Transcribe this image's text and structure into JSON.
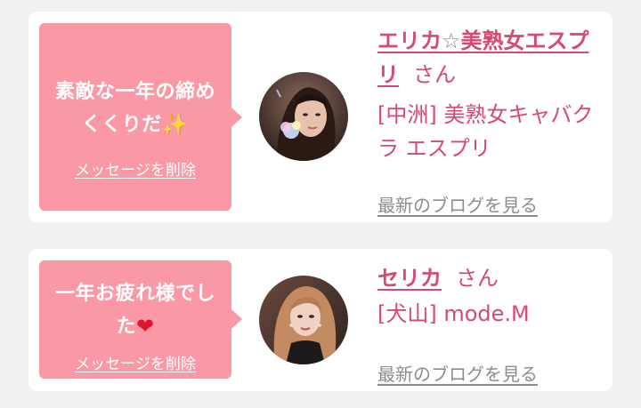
{
  "messages": [
    {
      "text": "素敵な一年の締めくくりだ",
      "emoji_icon": "sparkle-icon",
      "emoji": "✨",
      "delete_label": "メッセージを削除",
      "name_part1": "エリカ",
      "star": "☆",
      "name_part2": "美熟女エスプリ",
      "honorific": "さん",
      "shop": "[中洲] 美熟女キャバクラ エスプリ",
      "blog_label": "最新のブログを見る"
    },
    {
      "text": "一年お疲れ様でした",
      "emoji_icon": "heart-icon",
      "emoji": "❤",
      "delete_label": "メッセージを削除",
      "name": "セリカ",
      "honorific": "さん",
      "shop": "[犬山] mode.M",
      "blog_label": "最新のブログを見る"
    }
  ],
  "colors": {
    "background": "#f2f0f1",
    "card": "#ffffff",
    "bubble": "#fb98a6",
    "accent": "#d64a72",
    "muted_link": "#8d8d8d"
  }
}
